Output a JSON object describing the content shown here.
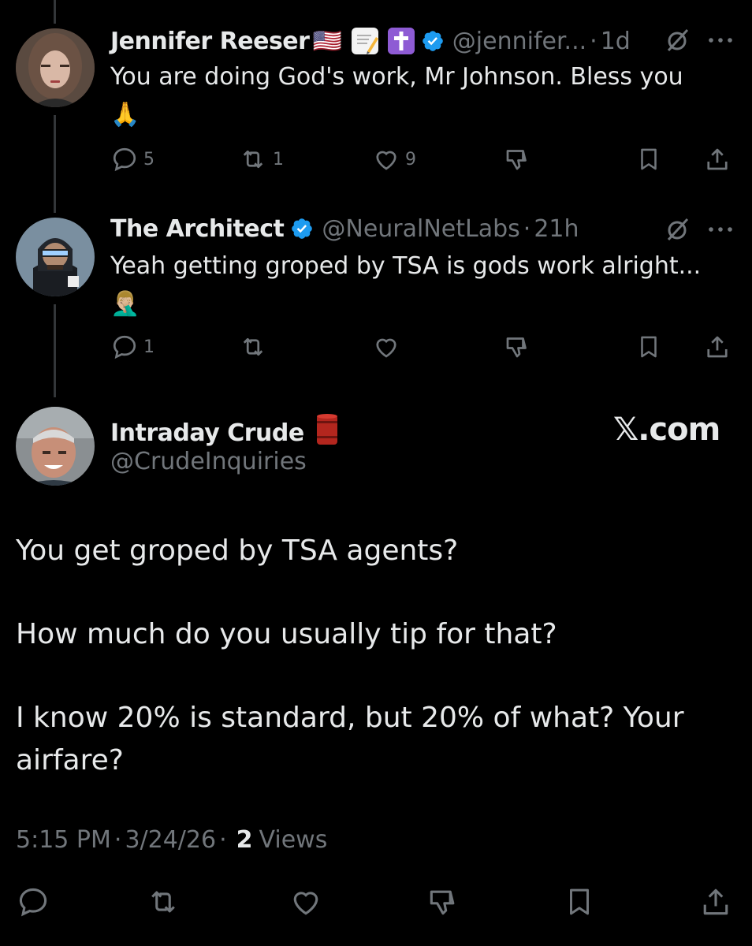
{
  "replies": [
    {
      "display_name": "Jennifer Reeser",
      "flag": "🇺🇸",
      "emoji_badges": [
        "memo-icon",
        "latin-cross-icon"
      ],
      "verified": true,
      "handle": "@jennifer...",
      "separator": "·",
      "time": "1d",
      "text": "You are doing God's work, Mr Johnson. Bless you",
      "text_emoji": "🙏",
      "counts": {
        "replies": "5",
        "reposts": "1",
        "likes": "9"
      }
    },
    {
      "display_name": "The Architect",
      "verified": true,
      "handle": "@NeuralNetLabs",
      "separator": "·",
      "time": "21h",
      "text": "Yeah getting groped by TSA is gods work alright...",
      "text_emoji": "🤦🏼‍♂️",
      "counts": {
        "replies": "1",
        "reposts": "",
        "likes": ""
      }
    }
  ],
  "main_post": {
    "display_name": "Intraday Crude",
    "name_emoji": "oil-drum-icon",
    "handle": "@CrudeInquiries",
    "brand": "𝕏.com",
    "paragraphs": [
      "You get groped by TSA agents?",
      "How much do you usually tip for that?",
      "I know 20% is standard, but 20% of what?  Your airfare?"
    ],
    "time": "5:15 PM",
    "separator": "·",
    "date": "3/24/26",
    "views_count": "2",
    "views_label": "Views"
  },
  "colors": {
    "background": "#000000",
    "text": "#e7e9ea",
    "muted": "#71767b",
    "verified": "#1d9bf0",
    "thread_line": "#333639"
  }
}
